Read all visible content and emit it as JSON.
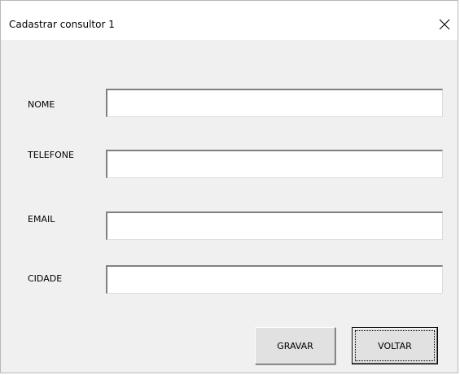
{
  "window": {
    "title": "Cadastrar consultor 1",
    "close_icon": "close-icon"
  },
  "form": {
    "fields": [
      {
        "label": "NOME",
        "value": ""
      },
      {
        "label": "TELEFONE",
        "value": ""
      },
      {
        "label": "EMAIL",
        "value": ""
      },
      {
        "label": "CIDADE",
        "value": ""
      }
    ]
  },
  "buttons": {
    "gravar_label": "GRAVAR",
    "voltar_label": "VOLTAR"
  },
  "colors": {
    "window_bg": "#f0f0f0",
    "titlebar_bg": "#ffffff",
    "button_bg": "#e1e1e1"
  }
}
